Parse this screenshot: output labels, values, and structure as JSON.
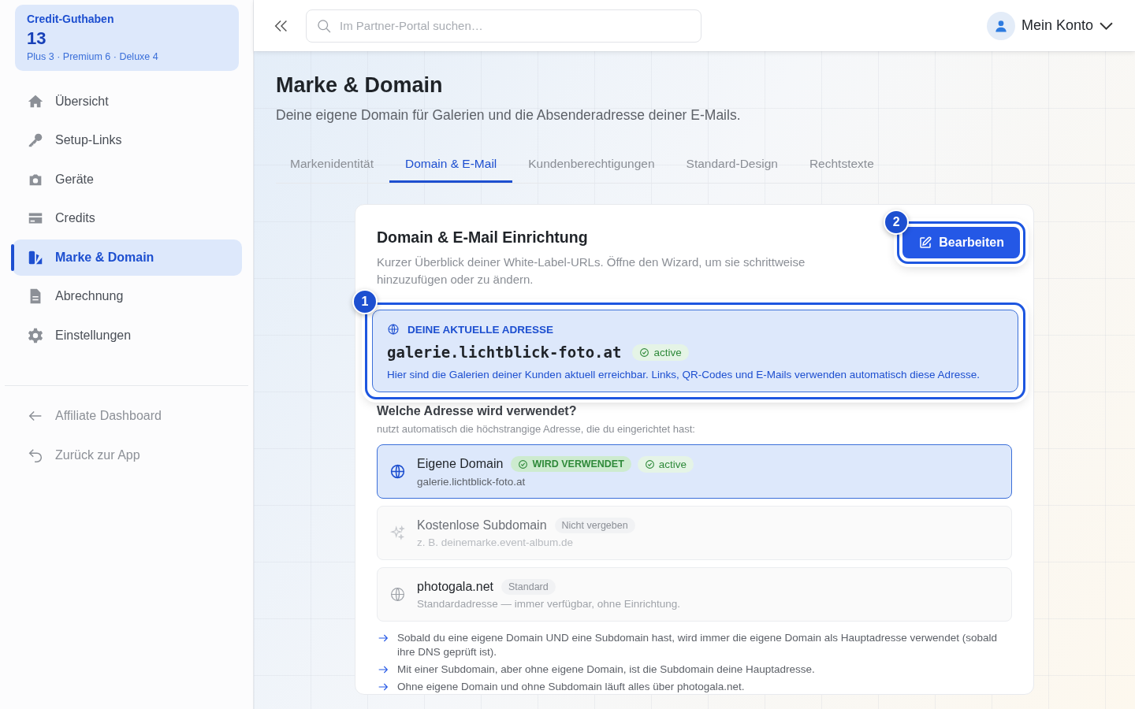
{
  "sidebar": {
    "credit_card": {
      "title": "Credit-Guthaben",
      "value": "13",
      "detail": "Plus 3 · Premium 6 · Deluxe 4"
    },
    "items": [
      {
        "kind": "home",
        "label": "Übersicht",
        "selected": false
      },
      {
        "kind": "key",
        "label": "Setup-Links",
        "selected": false
      },
      {
        "kind": "camera",
        "label": "Geräte",
        "selected": false
      },
      {
        "kind": "card",
        "label": "Credits",
        "selected": false
      },
      {
        "kind": "brand",
        "label": "Marke & Domain",
        "selected": true
      },
      {
        "kind": "doc",
        "label": "Abrechnung",
        "selected": false
      },
      {
        "kind": "gear",
        "label": "Einstellungen",
        "selected": false
      }
    ],
    "footer_items": [
      {
        "kind": "arrow",
        "label": "Affiliate Dashboard"
      },
      {
        "kind": "back",
        "label": "Zurück zur App"
      }
    ]
  },
  "topbar": {
    "search": {
      "placeholder": "Im Partner-Portal suchen…"
    },
    "account": "Mein Konto"
  },
  "page": {
    "title": "Marke & Domain",
    "subtitle": "Deine eigene Domain für Galerien und die Absenderadresse deiner E-Mails."
  },
  "tabs": [
    {
      "label": "Markenidentität",
      "selected": false
    },
    {
      "label": "Domain & E-Mail",
      "selected": true
    },
    {
      "label": "Kundenberechtigungen",
      "selected": false
    },
    {
      "label": "Standard-Design",
      "selected": false
    },
    {
      "label": "Rechtstexte",
      "selected": false
    }
  ],
  "card": {
    "title": "Domain & E-Mail Einrichtung",
    "description": "Kurzer Überblick deiner White-Label-URLs. Öffne den Wizard, um sie schrittweise hinzuzufügen oder zu ändern.",
    "edit_button": "Bearbeiten",
    "edit_marker": "2",
    "current": {
      "marker": "1",
      "label": "DEINE AKTUELLE ADRESSE",
      "address": "galerie.lichtblick-foto.at",
      "status": "active",
      "note": "Hier sind die Galerien deiner Kunden aktuell erreichbar. Links, QR-Codes und E-Mails verwenden automatisch diese Adresse."
    },
    "which_title": "Welche Adresse wird verwendet?",
    "which_hint": "nutzt automatisch die höchstrangige Adresse, die du eingerichtet hast:",
    "options": [
      {
        "kind": "globe",
        "title": "Eigene Domain",
        "detail": "galerie.lichtblick-foto.at",
        "selected": true,
        "disabled": false,
        "badges": [
          {
            "kind": "used",
            "label": "WIRD VERWENDET"
          },
          {
            "kind": "status",
            "label": "active"
          }
        ]
      },
      {
        "kind": "sparkle",
        "title": "Kostenlose Subdomain",
        "detail": "z. B. deinemarke.event-album.de",
        "selected": false,
        "disabled": true,
        "badges": [
          {
            "kind": "muted",
            "label": "Nicht vergeben"
          }
        ]
      },
      {
        "kind": "globe",
        "title": "photogala.net",
        "detail": "Standardadresse — immer verfügbar, ohne Einrichtung.",
        "selected": false,
        "disabled": false,
        "badges": [
          {
            "kind": "muted",
            "label": "Standard"
          }
        ]
      }
    ],
    "rules": [
      "Sobald du eine eigene Domain UND eine Subdomain hast, wird immer die eigene Domain als Hauptadresse verwendet (sobald ihre DNS geprüft ist).",
      "Mit einer Subdomain, aber ohne eigene Domain, ist die Subdomain deine Hauptadresse.",
      "Ohne eigene Domain und ohne Subdomain läuft alles über photogala.net."
    ]
  }
}
